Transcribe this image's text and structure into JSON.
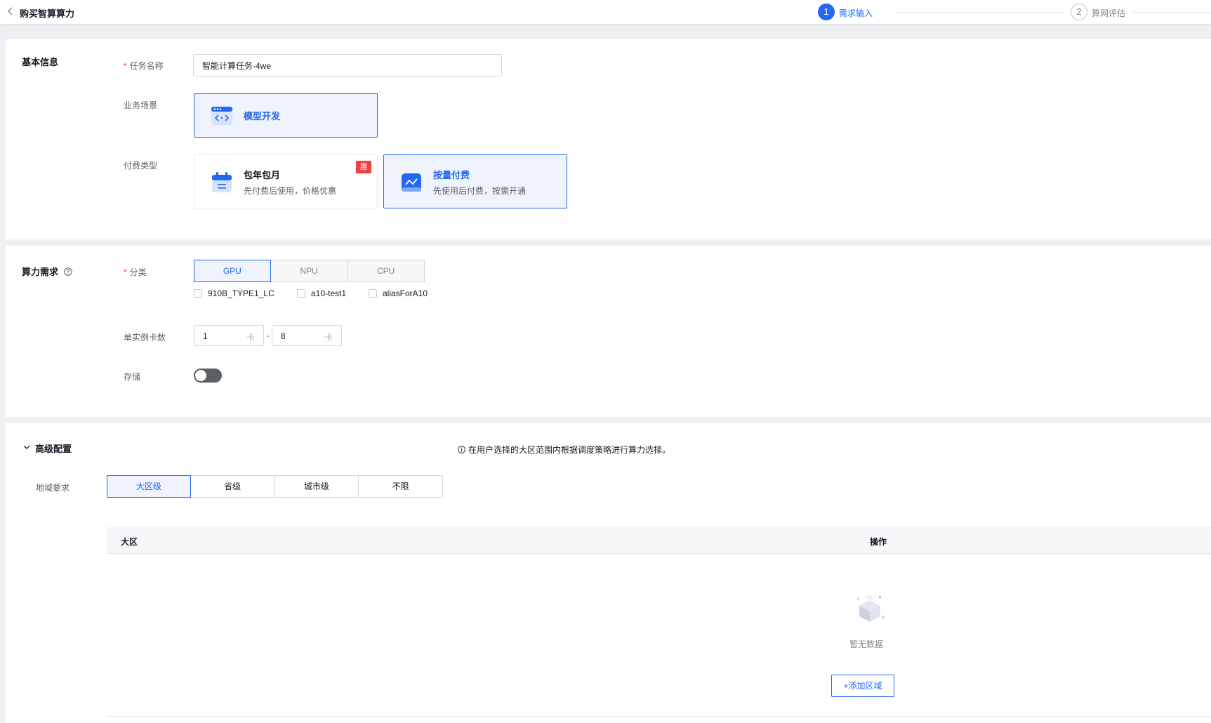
{
  "header": {
    "title": "购买智算算力",
    "steps": [
      {
        "number": "1",
        "label": "需求输入"
      },
      {
        "number": "2",
        "label": "算网评估"
      }
    ]
  },
  "basic_info": {
    "section_title": "基本信息",
    "task_name": {
      "label": "任务名称",
      "required_mark": "*",
      "value": "智能计算任务-4we"
    },
    "scenario": {
      "label": "业务场景",
      "option_title": "模型开发"
    },
    "billing": {
      "label": "付费类型",
      "options": [
        {
          "title": "包年包月",
          "desc": "先付费后使用，价格优惠",
          "badge": "惠",
          "selected": false
        },
        {
          "title": "按量付费",
          "desc": "先使用后付费，按需开通",
          "selected": true
        }
      ]
    }
  },
  "compute": {
    "section_title": "算力需求",
    "category": {
      "label": "分类",
      "required_mark": "*",
      "tabs": [
        "GPU",
        "NPU",
        "CPU"
      ],
      "active_tab": "GPU",
      "checkboxes": [
        "910B_TYPE1_LC",
        "a10-test1",
        "aliasForA10"
      ]
    },
    "cards": {
      "label": "单实例卡数",
      "min": "1",
      "max": "8",
      "unit": "卡",
      "separator": "-"
    },
    "storage": {
      "label": "存储",
      "enabled": false
    }
  },
  "advanced": {
    "section_title": "高级配置",
    "region": {
      "label": "地域要求",
      "options": [
        "大区级",
        "省级",
        "城市级",
        "不限"
      ],
      "active": "大区级",
      "tip": "在用户选择的大区范围内根据调度策略进行算力选择。"
    },
    "table": {
      "columns": [
        "大区",
        "操作"
      ],
      "empty_text": "暂无数据",
      "add_button": "+添加区域"
    }
  },
  "colors": {
    "primary": "#2468f2",
    "danger": "#f33e3e",
    "background": "#eef0f3"
  }
}
